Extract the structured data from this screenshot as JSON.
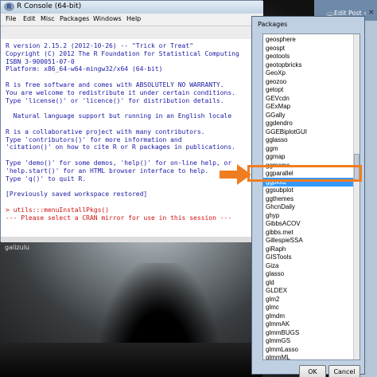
{
  "desktop": {
    "label": "galizulu"
  },
  "blog_tab": {
    "title": "Edit Post ‹",
    "close": "×"
  },
  "r_console": {
    "title": "R Console (64-bit)",
    "menu": [
      "File",
      "Edit",
      "Misc",
      "Packages",
      "Windows",
      "Help"
    ],
    "lines": [
      {
        "text": "R version 2.15.2 (2012-10-26) -- \"Trick or Treat\"",
        "style": "normal"
      },
      {
        "text": "Copyright (C) 2012 The R Foundation for Statistical Computing",
        "style": "normal"
      },
      {
        "text": "ISBN 3-900051-07-0",
        "style": "normal"
      },
      {
        "text": "Platform: x86_64-w64-mingw32/x64 (64-bit)",
        "style": "normal"
      },
      {
        "text": "",
        "style": "normal"
      },
      {
        "text": "R is free software and comes with ABSOLUTELY NO WARRANTY.",
        "style": "normal"
      },
      {
        "text": "You are welcome to redistribute it under certain conditions.",
        "style": "normal"
      },
      {
        "text": "Type 'license()' or 'licence()' for distribution details.",
        "style": "normal"
      },
      {
        "text": "",
        "style": "normal"
      },
      {
        "text": "  Natural language support but running in an English locale",
        "style": "normal"
      },
      {
        "text": "",
        "style": "normal"
      },
      {
        "text": "R is a collaborative project with many contributors.",
        "style": "normal"
      },
      {
        "text": "Type 'contributors()' for more information and",
        "style": "normal"
      },
      {
        "text": "'citation()' on how to cite R or R packages in publications.",
        "style": "normal"
      },
      {
        "text": "",
        "style": "normal"
      },
      {
        "text": "Type 'demo()' for some demos, 'help()' for on-line help, or",
        "style": "normal"
      },
      {
        "text": "'help.start()' for an HTML browser interface to help.",
        "style": "normal"
      },
      {
        "text": "Type 'q()' to quit R.",
        "style": "normal"
      },
      {
        "text": "",
        "style": "normal"
      },
      {
        "text": "[Previously saved workspace restored]",
        "style": "normal"
      },
      {
        "text": "",
        "style": "normal"
      },
      {
        "text": "> utils:::menuInstallPkgs()",
        "style": "red"
      },
      {
        "text": "--- Please select a CRAN mirror for use in this session ---",
        "style": "red"
      }
    ]
  },
  "packages_dialog": {
    "title": "Packages",
    "items": [
      "geosphere",
      "geospt",
      "geotools",
      "geotopbricks",
      "GeoXp",
      "geozoo",
      "getopt",
      "GEVcdn",
      "GExMap",
      "GGally",
      "ggdendro",
      "GGEBiplotGUI",
      "gglasso",
      "ggm",
      "ggmap",
      "ggmcmc",
      "ggparallel",
      "ggplot2",
      "ggsubplot",
      "ggthemes",
      "GhcnDaily",
      "ghyp",
      "GibbsACOV",
      "gibbs.met",
      "GillespieSSA",
      "giRaph",
      "GISTools",
      "Giza",
      "glasso",
      "gld",
      "GLDEX",
      "glm2",
      "glmc",
      "glmdm",
      "glmmAK",
      "glmmBUGS",
      "glmmGS",
      "glmmLasso",
      "glmmML"
    ],
    "selected": "ggplot2",
    "ok_label": "OK",
    "cancel_label": "Cancel"
  },
  "colors": {
    "highlight": "#f07d1f",
    "selection": "#3399ff",
    "console_text": "#1a1aa6",
    "console_command": "#d01010"
  }
}
